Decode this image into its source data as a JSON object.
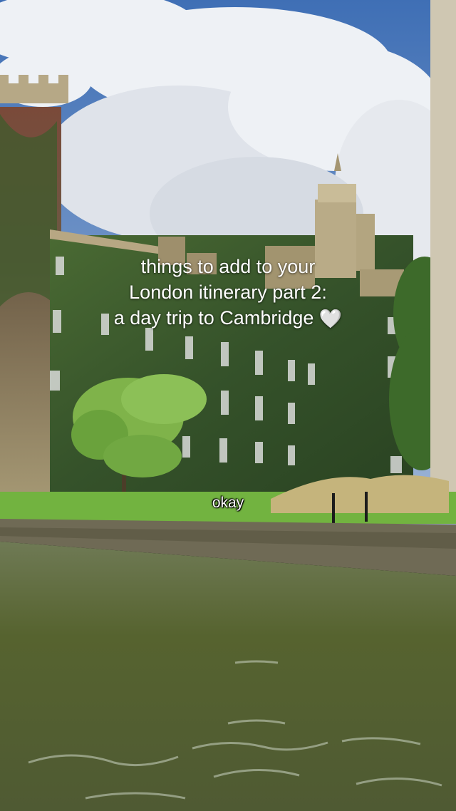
{
  "video": {
    "title_lines": [
      "things to add to your",
      "London itinerary part 2:",
      "a day trip to Cambridge"
    ],
    "title_emoji": "🤍",
    "subtitle": "okay"
  },
  "scene": {
    "sky": "#5b86c4",
    "cloud": "#eef1f5",
    "ivy": "#3c5a2c",
    "stone": "#a99a78",
    "lawn": "#6fae3e",
    "river": "#5f6a3f"
  }
}
